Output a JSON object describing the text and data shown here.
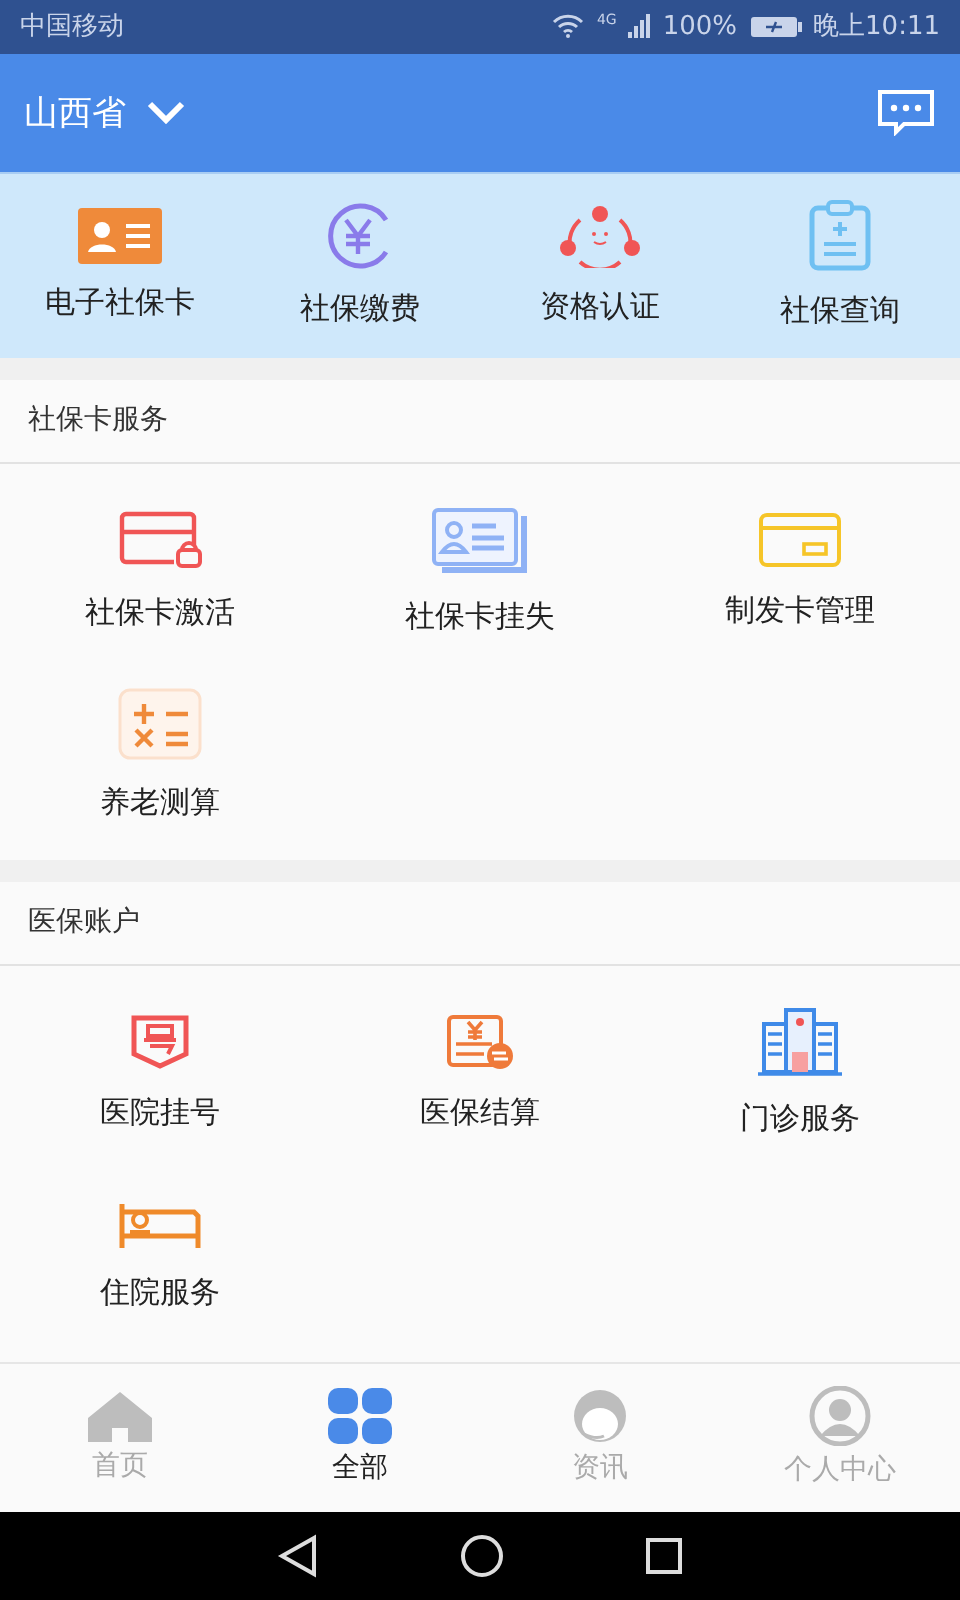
{
  "status_bar": {
    "carrier": "中国移动",
    "network": "4G",
    "battery": "100%",
    "time": "晚上10:11"
  },
  "header": {
    "province": "山西省"
  },
  "quick_actions": [
    {
      "label": "电子社保卡",
      "kind": "idcard"
    },
    {
      "label": "社保缴费",
      "kind": "yuan"
    },
    {
      "label": "资格认证",
      "kind": "face"
    },
    {
      "label": "社保查询",
      "kind": "clipboard"
    }
  ],
  "sections": [
    {
      "title": "社保卡服务",
      "items": [
        {
          "label": "社保卡激活",
          "kind": "cardlock"
        },
        {
          "label": "社保卡挂失",
          "kind": "cards"
        },
        {
          "label": "制发卡管理",
          "kind": "card"
        },
        {
          "label": "养老测算",
          "kind": "calc"
        }
      ]
    },
    {
      "title": "医保账户",
      "items": [
        {
          "label": "医院挂号",
          "kind": "ticket"
        },
        {
          "label": "医保结算",
          "kind": "bill"
        },
        {
          "label": "门诊服务",
          "kind": "hospital"
        },
        {
          "label": "住院服务",
          "kind": "bed"
        }
      ]
    }
  ],
  "tabs": [
    {
      "label": "首页",
      "kind": "home",
      "selected": false
    },
    {
      "label": "全部",
      "kind": "grid",
      "selected": true
    },
    {
      "label": "资讯",
      "kind": "agent",
      "selected": false
    },
    {
      "label": "个人中心",
      "kind": "user",
      "selected": false
    }
  ]
}
